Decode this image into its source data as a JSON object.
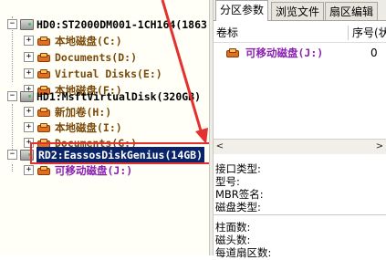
{
  "tree": {
    "disks": [
      {
        "label": "HD0:ST2000DM001-1CH164(1863",
        "expander": "−",
        "partitions": [
          {
            "label": "本地磁盘(C:)",
            "expander": "+"
          },
          {
            "label": "Documents(D:)",
            "expander": "+"
          },
          {
            "label": "Virtual Disks(E:)",
            "expander": "+"
          },
          {
            "label": "本地磁盘(F:)",
            "expander": "+"
          }
        ]
      },
      {
        "label": "HD1:MsftVirtualDisk(320GB)",
        "expander": "−",
        "partitions": [
          {
            "label": "新加卷(H:)",
            "expander": "+"
          },
          {
            "label": "本地磁盘(I:)",
            "expander": "+"
          },
          {
            "label": "Documents(G:)",
            "expander": "+"
          }
        ]
      },
      {
        "label": "RD2:EassosDiskGenius(14GB)",
        "expander": "−",
        "selected": true,
        "partitions": [
          {
            "label": "可移动磁盘(J:)",
            "expander": "+"
          }
        ]
      }
    ]
  },
  "tabs": [
    {
      "label": "分区参数",
      "active": true
    },
    {
      "label": "浏览文件",
      "active": false
    },
    {
      "label": "扇区编辑",
      "active": false
    }
  ],
  "list": {
    "columns": [
      "卷标",
      "序号(状"
    ],
    "rows": [
      {
        "volume": "可移动磁盘(J:)",
        "index": "0"
      }
    ]
  },
  "scrollbar": {
    "left_arrow": "<",
    "right_arrow": ">"
  },
  "info": {
    "group1": [
      "接口类型:",
      "型号:",
      "MBR签名:",
      "磁盘类型:"
    ],
    "group2": [
      "柱面数:",
      "磁头数:",
      "每道扇区数:"
    ]
  },
  "colors": {
    "selection": "#0a246a",
    "highlight_box": "#e53030",
    "partition_text": "#7a4a0a",
    "removable_text": "#8a20b0"
  }
}
